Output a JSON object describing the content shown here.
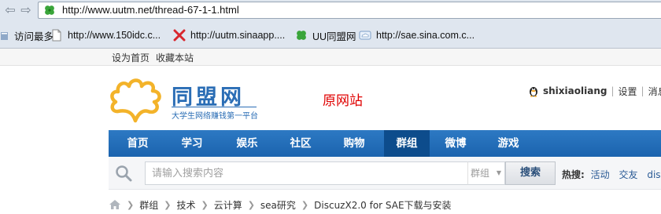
{
  "browser": {
    "url": "http://www.uutm.net/thread-67-1-1.html",
    "bookmarks": [
      {
        "icon": "bookmark-folder-icon",
        "label": "访问最多"
      },
      {
        "icon": "page-icon",
        "label": "http://www.150idc.c..."
      },
      {
        "icon": "sina-app-icon",
        "label": "http://uutm.sinaapp...."
      },
      {
        "icon": "clover-icon",
        "label": "UU同盟网"
      },
      {
        "icon": "sae-cloud-icon",
        "label": "http://sae.sina.com.c..."
      }
    ]
  },
  "topbar": {
    "set_home": "设为首页",
    "bookmark_site": "收藏本站"
  },
  "header": {
    "logo_name": "同盟网",
    "logo_slogan": "大学生网络赚钱第一平台",
    "original_site": "原网站",
    "username": "shixiaoliang",
    "settings": "设置",
    "messages": "消息"
  },
  "nav": {
    "items": [
      "首页",
      "学习",
      "娱乐",
      "社区",
      "购物",
      "群组",
      "微博",
      "游戏"
    ],
    "active_index": 5
  },
  "search": {
    "placeholder": "请输入搜索内容",
    "scope": "群组",
    "button": "搜索",
    "hot_label": "热搜:",
    "hot_words": [
      "活动",
      "交友",
      "discu"
    ]
  },
  "breadcrumb": [
    "群组",
    "技术",
    "云计算",
    "sea研究",
    "DiscuzX2.0 for SAE下载与安装"
  ],
  "colors": {
    "brand_blue": "#2a6db5",
    "nav_blue": "#2d79c3",
    "nav_active": "#0d4c8c",
    "original_site_red": "#e00000"
  }
}
